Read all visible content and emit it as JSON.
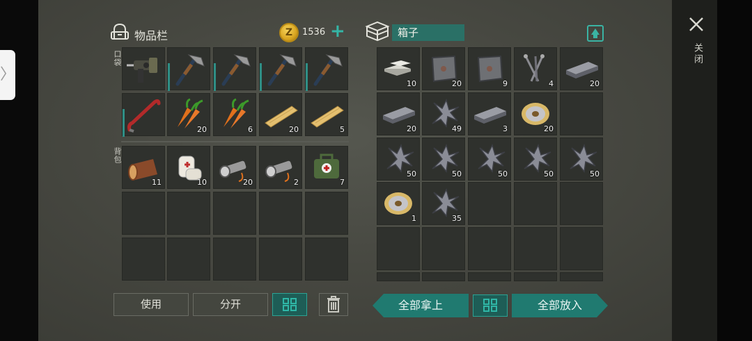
{
  "inventory": {
    "title": "物品栏",
    "coins": "1536",
    "pocket_label": "口袋",
    "backpack_label": "背包",
    "pocket": [
      {
        "item": "drill",
        "qty": ""
      },
      {
        "item": "hatchet",
        "qty": ""
      },
      {
        "item": "hatchet",
        "qty": ""
      },
      {
        "item": "hatchet",
        "qty": ""
      },
      {
        "item": "hatchet",
        "qty": ""
      },
      {
        "item": "crowbar",
        "qty": ""
      },
      {
        "item": "carrots",
        "qty": "20"
      },
      {
        "item": "carrots",
        "qty": "6"
      },
      {
        "item": "plank",
        "qty": "20"
      },
      {
        "item": "plank",
        "qty": "5"
      }
    ],
    "backpack": [
      {
        "item": "log",
        "qty": "11"
      },
      {
        "item": "bandage",
        "qty": "10"
      },
      {
        "item": "flashlight",
        "qty": "20"
      },
      {
        "item": "flashlight",
        "qty": "2"
      },
      {
        "item": "medkit",
        "qty": "7"
      }
    ]
  },
  "box": {
    "title": "箱子",
    "items": [
      {
        "item": "metal-bars",
        "qty": "10"
      },
      {
        "item": "iron-plate",
        "qty": "20"
      },
      {
        "item": "iron-plate",
        "qty": "9"
      },
      {
        "item": "nails",
        "qty": "4"
      },
      {
        "item": "iron-ingot",
        "qty": "20"
      },
      {
        "item": "iron-ingot",
        "qty": "20"
      },
      {
        "item": "scrap-metal",
        "qty": "49"
      },
      {
        "item": "iron-ingot",
        "qty": "3"
      },
      {
        "item": "wire-spool",
        "qty": "20"
      },
      {
        "item": "",
        "qty": ""
      },
      {
        "item": "scrap-metal",
        "qty": "50"
      },
      {
        "item": "scrap-metal",
        "qty": "50"
      },
      {
        "item": "scrap-metal",
        "qty": "50"
      },
      {
        "item": "scrap-metal",
        "qty": "50"
      },
      {
        "item": "scrap-metal",
        "qty": "50"
      },
      {
        "item": "wire-spool",
        "qty": "1"
      },
      {
        "item": "scrap-metal",
        "qty": "35"
      }
    ]
  },
  "buttons": {
    "use": "使用",
    "split": "分开",
    "take_all": "全部拿上",
    "put_all": "全部放入",
    "close": "关闭"
  },
  "colors": {
    "accent": "#2ba394",
    "slot_bg": "#2f312d"
  }
}
